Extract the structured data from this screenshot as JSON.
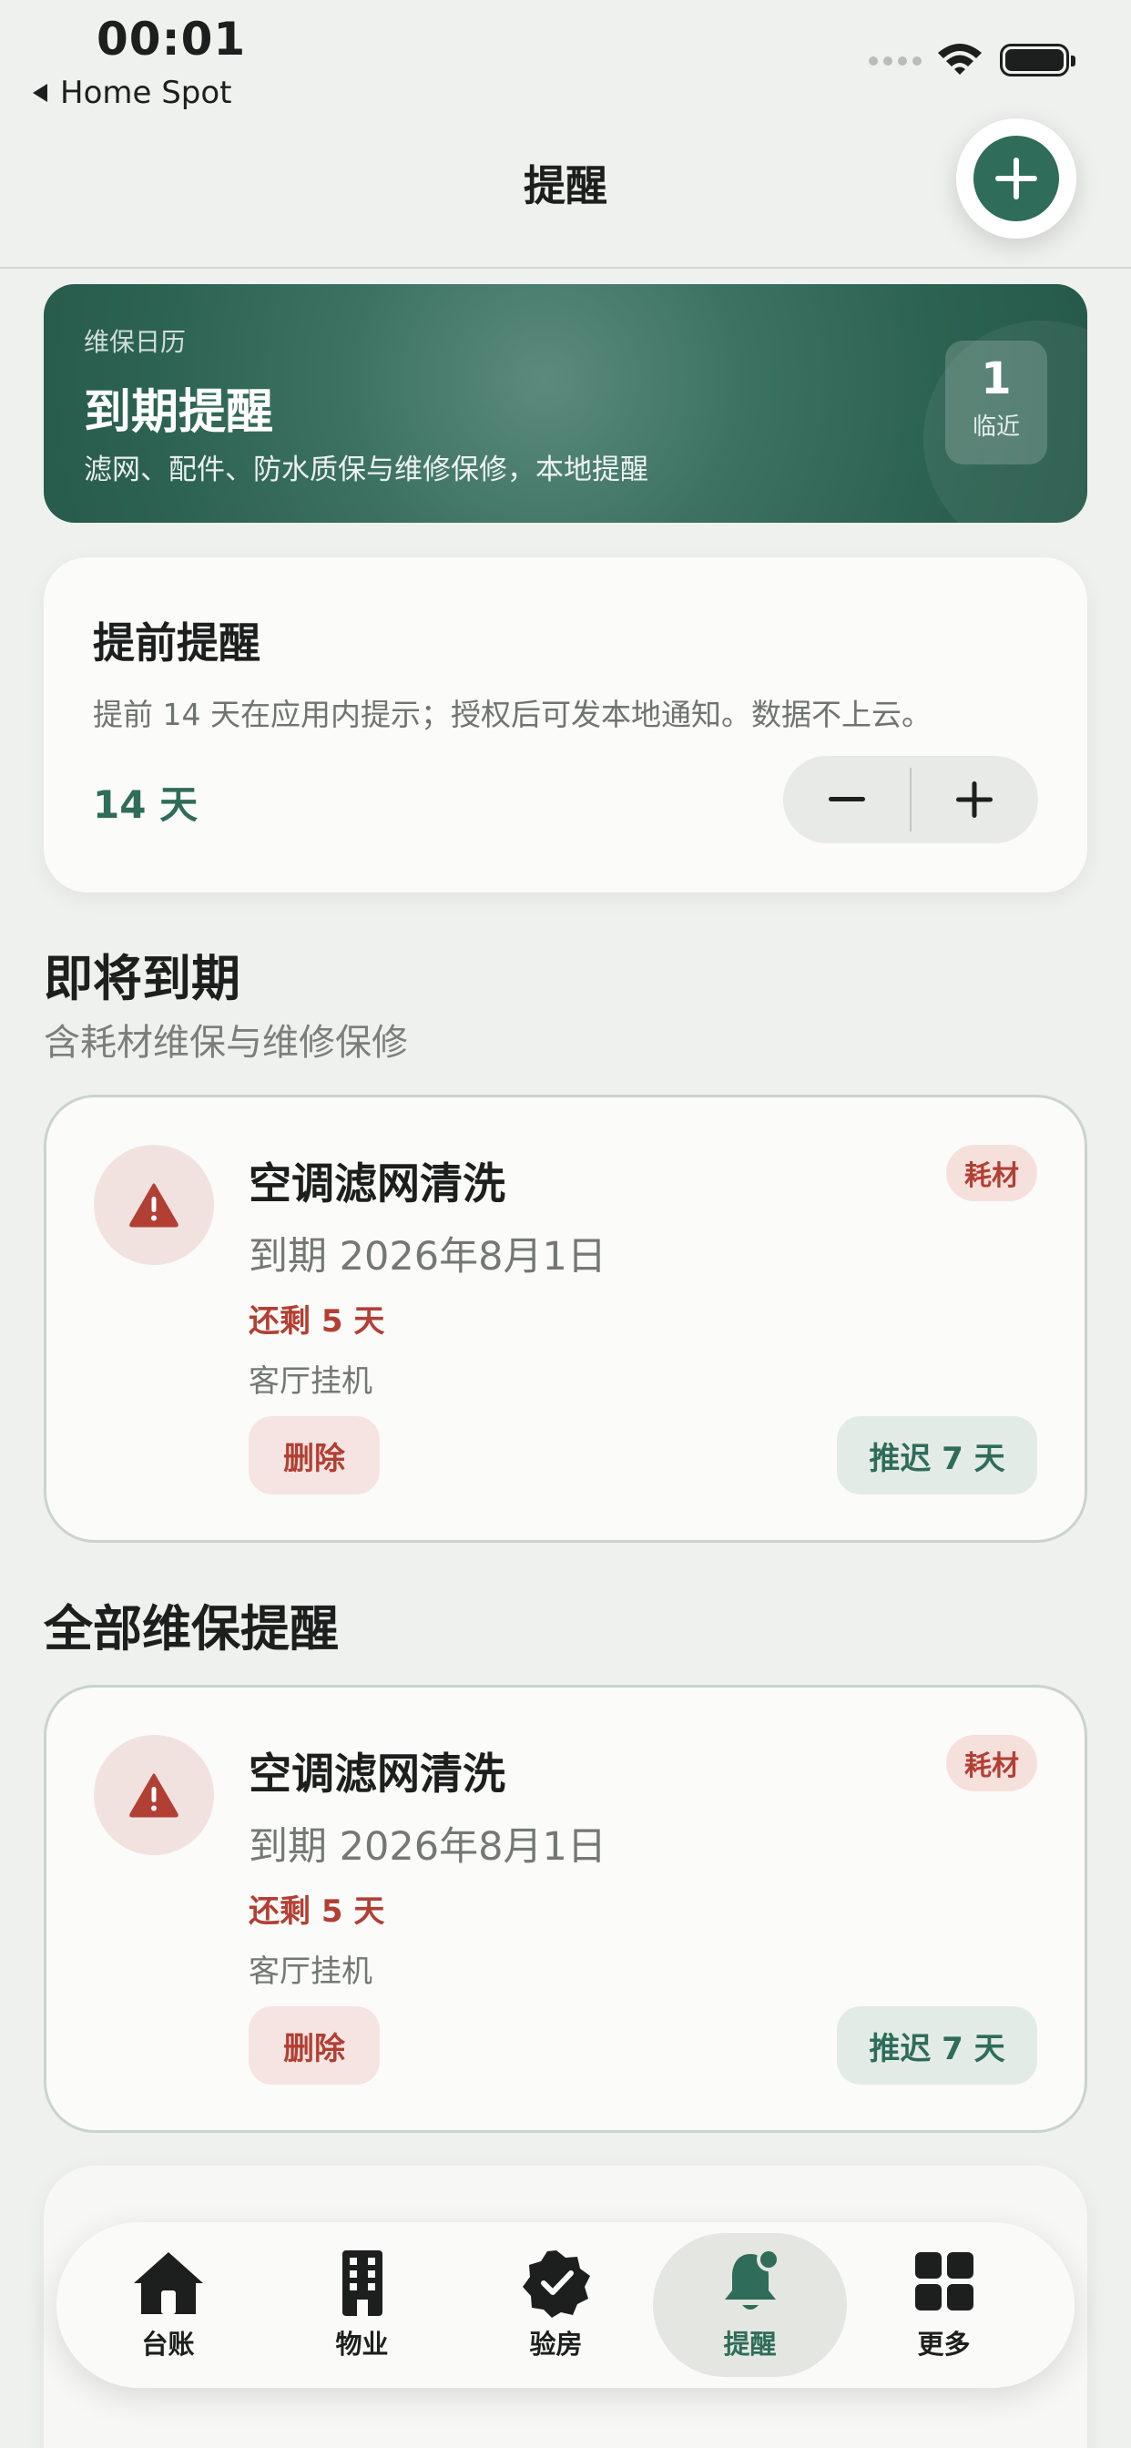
{
  "status_bar": {
    "time": "00:01",
    "back_label": "Home Spot"
  },
  "nav": {
    "title": "提醒"
  },
  "hero": {
    "kicker": "维保日历",
    "title": "到期提醒",
    "subtitle": "滤网、配件、防水质保与维修保修，本地提醒",
    "badge_count": "1",
    "badge_label": "临近"
  },
  "advance": {
    "title": "提前提醒",
    "description": "提前 14 天在应用内提示；授权后可发本地通知。数据不上云。",
    "days_label": "14 天"
  },
  "upcoming": {
    "title": "即将到期",
    "subtitle": "含耗材维保与维修保修",
    "items": [
      {
        "icon": "warning-icon",
        "title": "空调滤网清洗",
        "due": "到期 2026年8月1日",
        "remaining": "还剩 5 天",
        "location": "客厅挂机",
        "tag": "耗材",
        "delete_label": "删除",
        "postpone_label": "推迟 7 天"
      }
    ]
  },
  "all": {
    "title": "全部维保提醒",
    "items": [
      {
        "icon": "warning-icon",
        "title": "空调滤网清洗",
        "due": "到期 2026年8月1日",
        "remaining": "还剩 5 天",
        "location": "客厅挂机",
        "tag": "耗材",
        "delete_label": "删除",
        "postpone_label": "推迟 7 天"
      }
    ]
  },
  "tabbar": {
    "items": [
      {
        "label": "台账",
        "icon": "house-icon"
      },
      {
        "label": "物业",
        "icon": "building-icon"
      },
      {
        "label": "验房",
        "icon": "seal-check-icon"
      },
      {
        "label": "提醒",
        "icon": "bell-badge-icon",
        "active": true
      },
      {
        "label": "更多",
        "icon": "grid-icon"
      }
    ]
  },
  "colors": {
    "accent": "#2f6c5a",
    "danger": "#b23f34",
    "background": "#eef1ed"
  }
}
